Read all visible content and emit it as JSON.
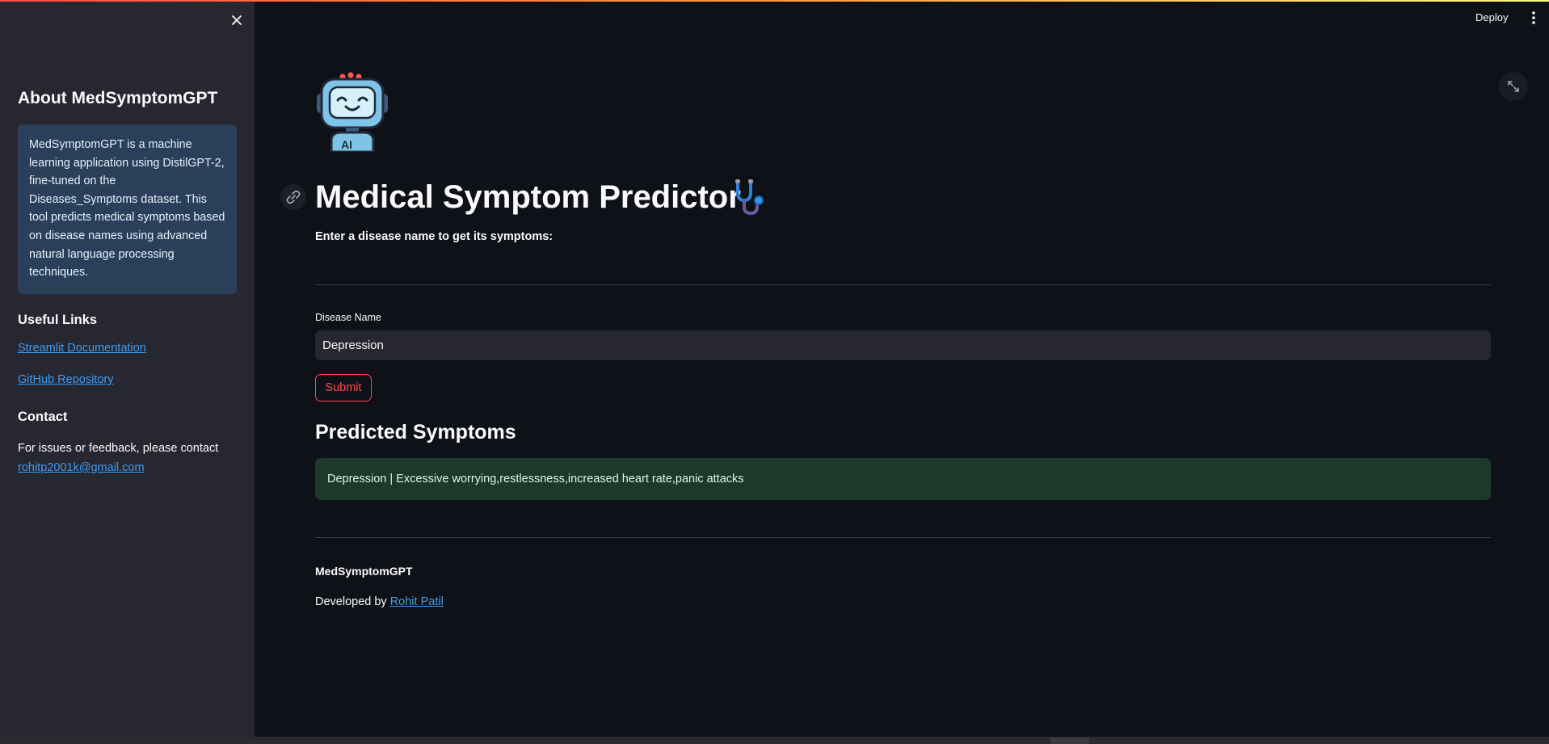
{
  "sidebar": {
    "about_title": "About MedSymptomGPT",
    "about_text": "MedSymptomGPT is a machine learning application using DistilGPT-2, fine-tuned on the Diseases_Symptoms dataset. This tool predicts medical symptoms based on disease names using advanced natural language processing techniques.",
    "useful_links_heading": "Useful Links",
    "links": [
      {
        "label": "Streamlit Documentation"
      },
      {
        "label": "GitHub Repository"
      }
    ],
    "contact_heading": "Contact",
    "contact_text": "For issues or feedback, please contact",
    "contact_email": "rohitp2001k@gmail.com"
  },
  "header": {
    "deploy_label": "Deploy"
  },
  "main": {
    "title": "Medical Symptom Predictor",
    "subtitle": "Enter a disease name to get its symptoms:",
    "input_label": "Disease Name",
    "input_value": "Depression",
    "submit_label": "Submit",
    "results_heading": "Predicted Symptoms",
    "result_text": "Depression | Excessive worrying,restlessness,increased heart rate,panic attacks"
  },
  "footer": {
    "app_name": "MedSymptomGPT",
    "developed_by": "Developed by",
    "author": "Rohit Patil"
  },
  "colors": {
    "background": "#0e1117",
    "sidebar": "#262730",
    "accent": "#ff4b4b",
    "info_box": "#2a3f5a",
    "success_box": "#1b3a2a",
    "link": "#3d9df3"
  },
  "icons": {
    "close": "close-icon",
    "menu": "kebab-menu-icon",
    "fullscreen": "expand-icon",
    "anchor": "link-icon",
    "logo": "robot-ai-icon",
    "title_emoji": "stethoscope-icon"
  }
}
